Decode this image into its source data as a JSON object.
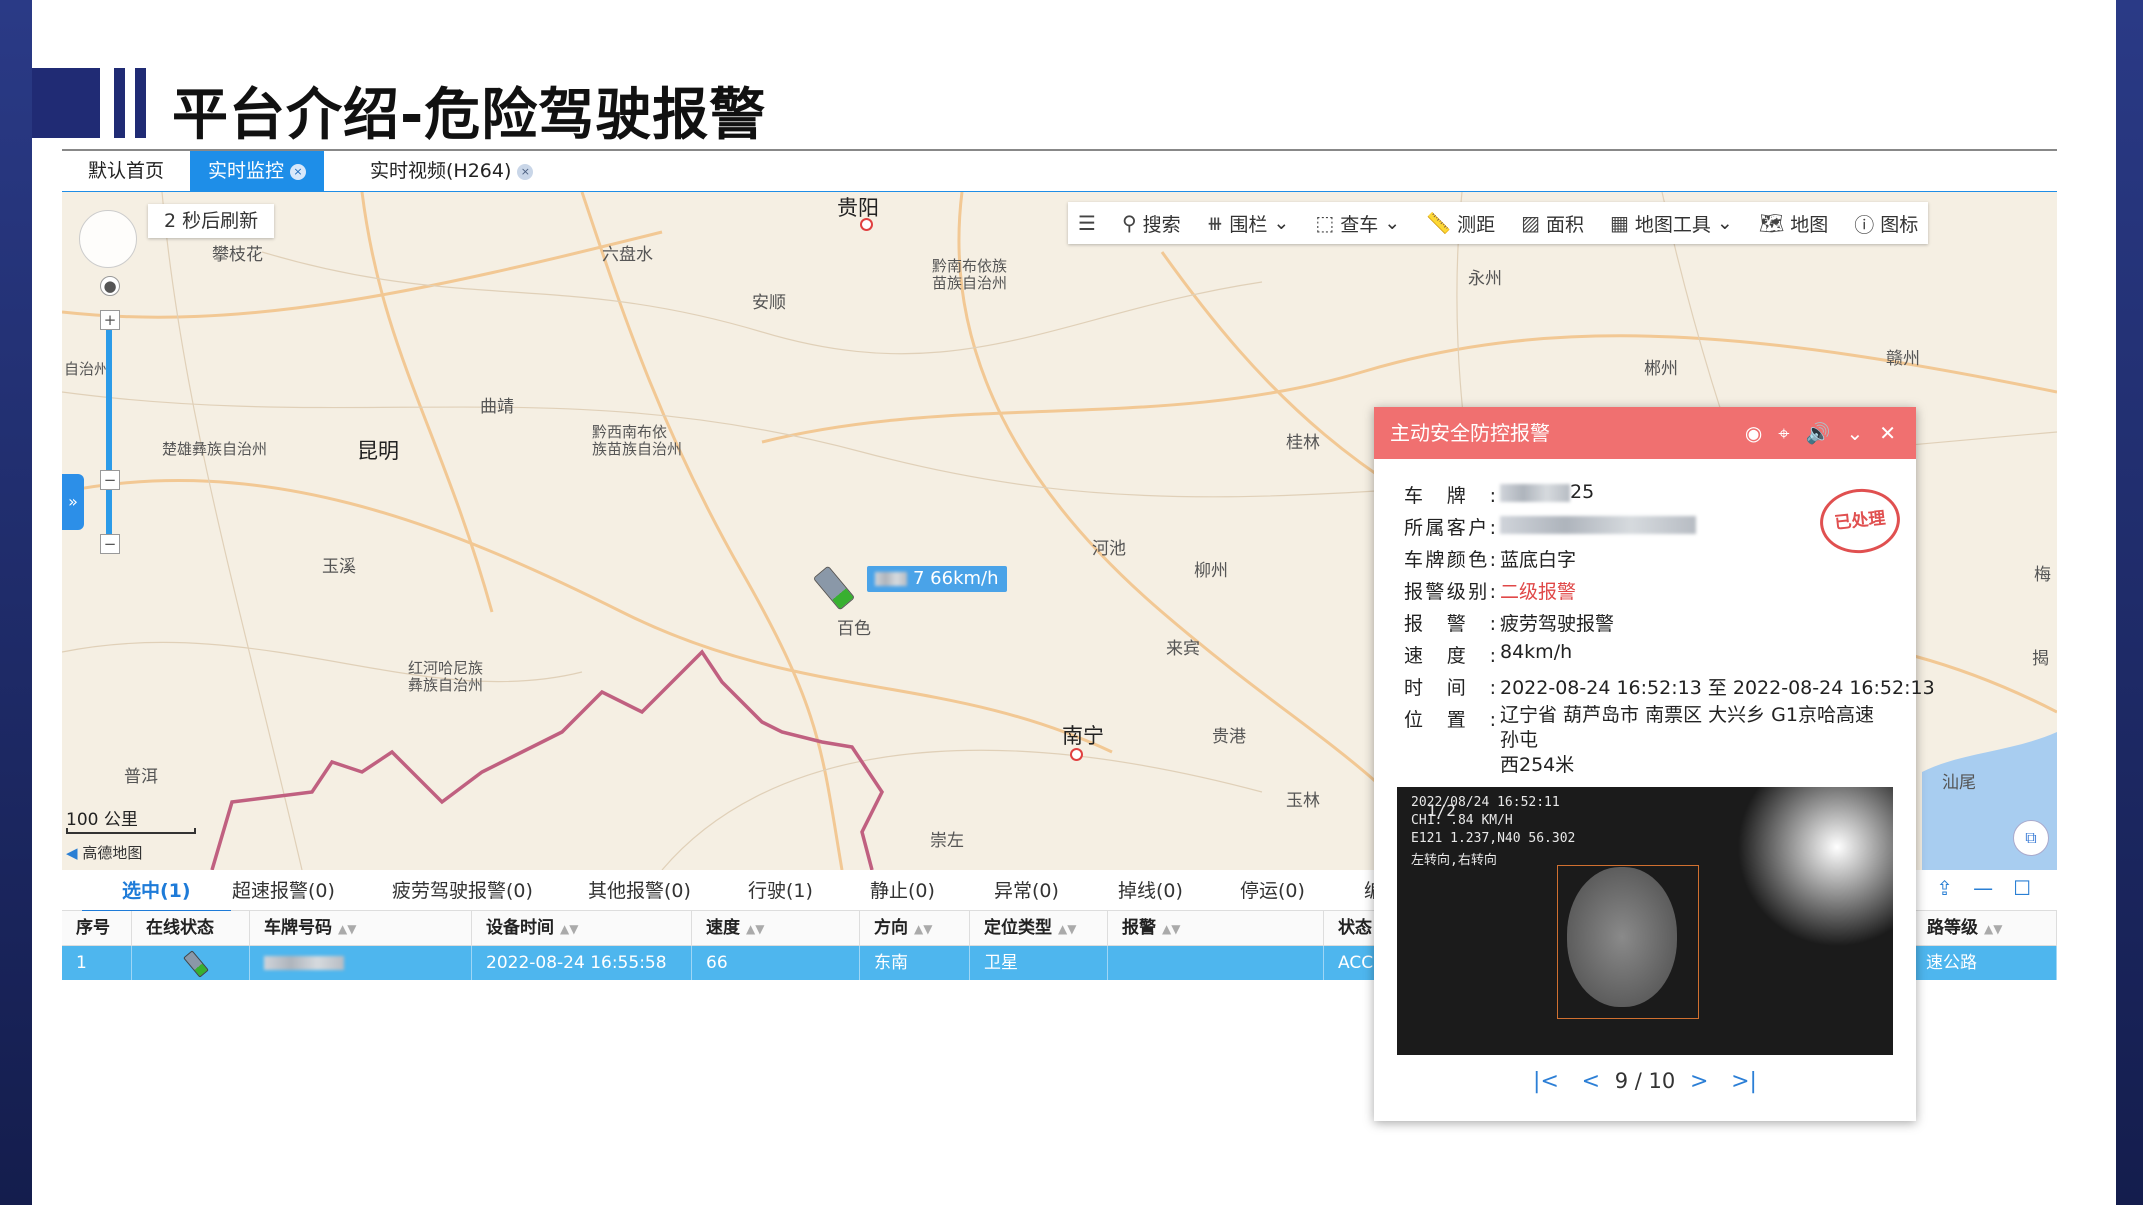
{
  "page_title": "平台介绍-危险驾驶报警",
  "tabs": [
    {
      "label": "默认首页"
    },
    {
      "label": "实时监控",
      "close": "×"
    },
    {
      "label": "实时视频(H264)",
      "close": "×"
    }
  ],
  "map": {
    "refresh_text": "2  秒后刷新",
    "side_tab": "»",
    "toolbar": [
      {
        "icon": "list-icon",
        "label": ""
      },
      {
        "icon": "search-icon",
        "label": "搜索"
      },
      {
        "icon": "fence-icon",
        "label": "围栏"
      },
      {
        "icon": "select-vehicle-icon",
        "label": "查车"
      },
      {
        "icon": "ruler-icon",
        "label": "测距"
      },
      {
        "icon": "area-icon",
        "label": "面积"
      },
      {
        "icon": "map-tools-icon",
        "label": "地图工具"
      },
      {
        "icon": "map-icon",
        "label": "地图"
      },
      {
        "icon": "help-icon",
        "label": "图标"
      }
    ],
    "cities": [
      {
        "name": "贵阳",
        "big": true
      },
      {
        "name": "六盘水"
      },
      {
        "name": "安顺"
      },
      {
        "name": "黔南布依族\n苗族自治州"
      },
      {
        "name": "攀枝花"
      },
      {
        "name": "曲靖"
      },
      {
        "name": "昆明",
        "big": true
      },
      {
        "name": "楚雄彝族自治州"
      },
      {
        "name": "黔西南布依\n族苗族自治州"
      },
      {
        "name": "玉溪"
      },
      {
        "name": "百色"
      },
      {
        "name": "河池"
      },
      {
        "name": "柳州"
      },
      {
        "name": "来宾"
      },
      {
        "name": "桂林"
      },
      {
        "name": "永州"
      },
      {
        "name": "郴州"
      },
      {
        "name": "赣州"
      },
      {
        "name": "红河哈尼族\n彝族自治州"
      },
      {
        "name": "普洱"
      },
      {
        "name": "南宁",
        "big": true
      },
      {
        "name": "贵港"
      },
      {
        "name": "崇左"
      },
      {
        "name": "玉林"
      },
      {
        "name": "汕尾"
      },
      {
        "name": "自治州"
      },
      {
        "name": "梅"
      },
      {
        "name": "揭"
      }
    ],
    "vehicle_speed_label": "7 66km/h",
    "scale_label": "100 公里",
    "attribution": "高德地图"
  },
  "alarm_tabs": [
    {
      "label": "选中(1)",
      "active": true
    },
    {
      "label": "超速报警(0)"
    },
    {
      "label": "疲劳驾驶报警(0)"
    },
    {
      "label": "其他报警(0)"
    },
    {
      "label": "行驶(1)"
    },
    {
      "label": "静止(0)"
    },
    {
      "label": "异常(0)"
    },
    {
      "label": "掉线(0)"
    },
    {
      "label": "停运(0)"
    },
    {
      "label": "编"
    }
  ],
  "grid": {
    "columns": [
      "序号",
      "在线状态",
      "车牌号码",
      "设备时间",
      "速度",
      "方向",
      "定位类型",
      "报警",
      "状态",
      "路等级"
    ],
    "rows": [
      {
        "index": "1",
        "plate": "",
        "time": "2022-08-24 16:55:58",
        "speed": "66",
        "direction": "东南",
        "loc_type": "卫星",
        "alarm": "",
        "status": "ACC",
        "road_level": "速公路"
      }
    ]
  },
  "popup": {
    "title": "主动安全防控报警",
    "stamp": "已处理",
    "fields": [
      {
        "label": "车牌:",
        "value": "25"
      },
      {
        "label": "所属客户:",
        "value": ""
      },
      {
        "label": "车牌颜色:",
        "value": "蓝底白字"
      },
      {
        "label": "报警级别:",
        "value": "二级报警"
      },
      {
        "label": "报警:",
        "value": "疲劳驾驶报警"
      },
      {
        "label": "速度:",
        "value": "84km/h"
      },
      {
        "label": "时间:",
        "value": "2022-08-24 16:52:13 至 2022-08-24 16:52:13"
      },
      {
        "label": "位置:",
        "value": "辽宁省 葫芦岛市 南票区 大兴乡 G1京哈高速 孙屯\n西254米"
      }
    ],
    "camera": {
      "line1": "2022/08/24 16:52:11",
      "line2": "CH1:        .84 KM/H",
      "line3": "E121 1.237,N40 56.302",
      "line4": "左转向,右转向",
      "counter": "1/2"
    },
    "pager": {
      "current": "9",
      "separator": "/",
      "total": "10"
    }
  },
  "colors": {
    "brand_dark": "#202b74",
    "tab_active": "#1e8ee8",
    "popup_header": "#f07070",
    "alarm_level": "#e04848",
    "row_selected": "#4eb6ee"
  }
}
